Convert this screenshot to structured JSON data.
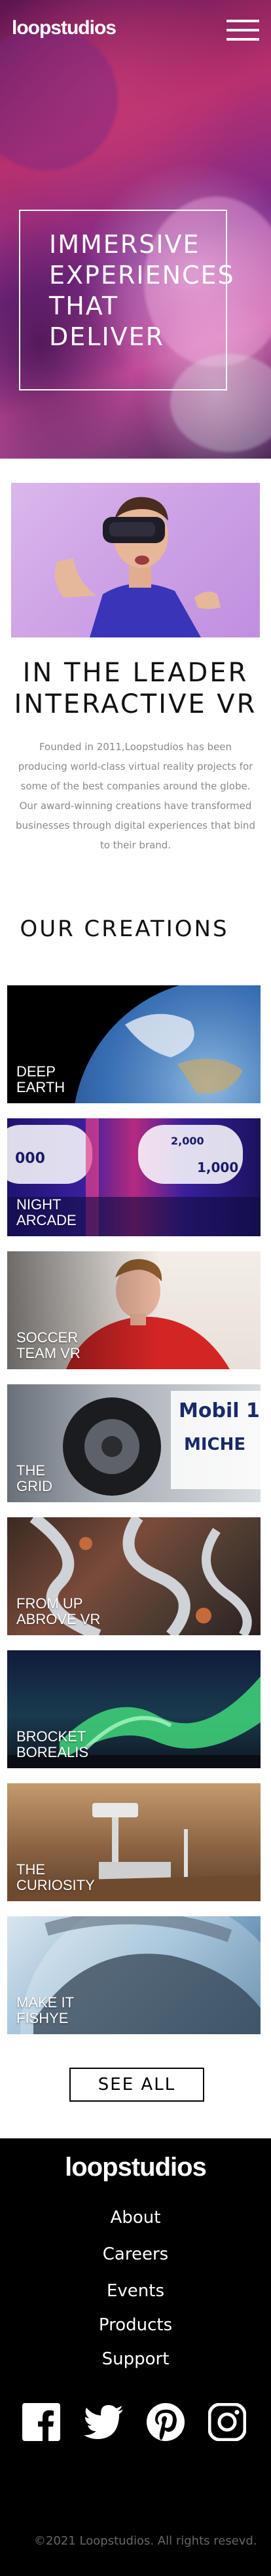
{
  "header": {
    "logo": "loopstudios",
    "menu_icon": "hamburger-menu-icon"
  },
  "hero": {
    "lines": [
      "IMMERSIVE",
      "EXPERIENCES",
      "THAT",
      "DELIVER"
    ]
  },
  "intro": {
    "title_lines": [
      "IN THE LEADER",
      "INTERACTIVE VR"
    ],
    "text": "Founded in 2011,Loopstudios has been producing world-class virtual reality projects for some of the best companies around the globe. Our award-winning creations have transformed businesses through digital experiences that bind to their brand."
  },
  "creations": {
    "title": "OUR CREATIONS",
    "items": [
      {
        "label": "DEEP\nEARTH"
      },
      {
        "label": "NIGHT\nARCADE"
      },
      {
        "label": "SOCCER\nTEAM VR"
      },
      {
        "label": "THE\nGRID"
      },
      {
        "label": "FROM UP\nABROVE VR"
      },
      {
        "label": "BROCKET\nBOREALIS"
      },
      {
        "label": "THE\nCURIOSITY"
      },
      {
        "label": "MAKE IT\nFISHYE"
      }
    ],
    "see_all": "SEE ALL"
  },
  "footer": {
    "logo": "loopstudios",
    "nav": [
      "About",
      "Careers",
      "Events",
      "Products",
      "Support"
    ],
    "social_icons": [
      "facebook-icon",
      "twitter-icon",
      "pinterest-icon",
      "instagram-icon"
    ],
    "copyright": "©2021 Loopstudios. All rights resevd."
  }
}
